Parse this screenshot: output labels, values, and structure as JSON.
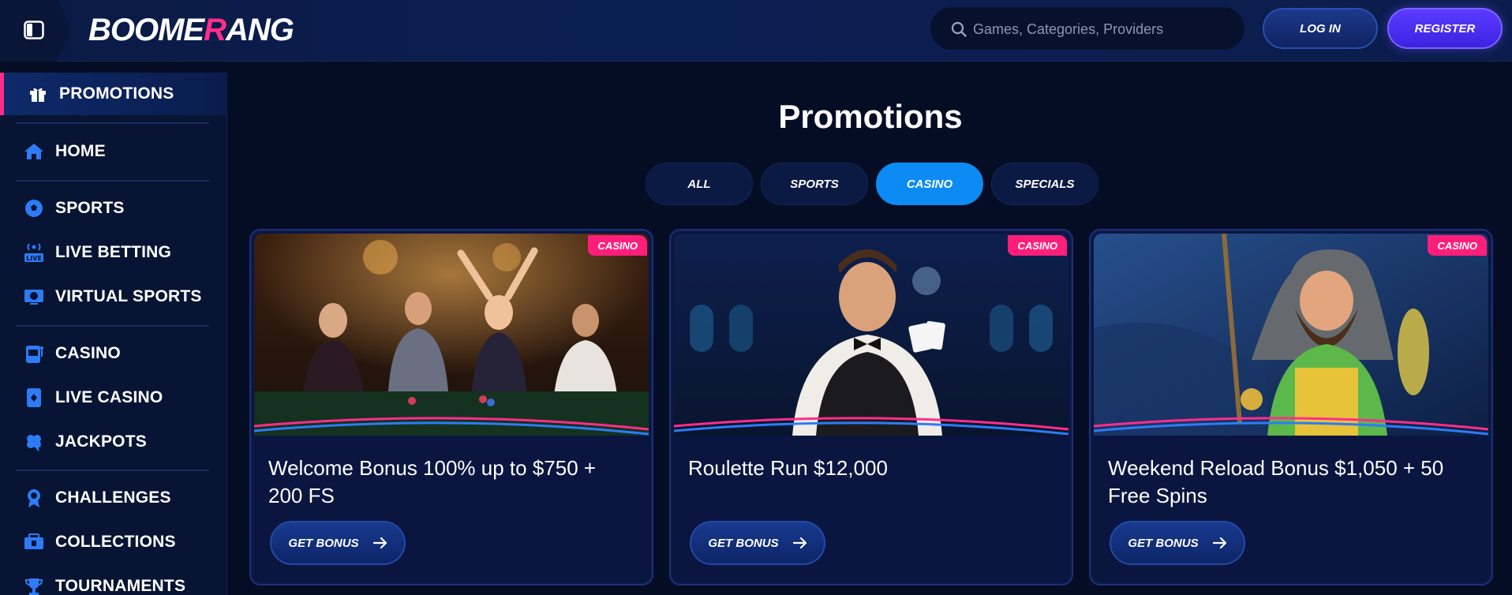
{
  "header": {
    "logo_text_a": "BOOME",
    "logo_text_b": "R",
    "logo_text_c": "ANG",
    "search_placeholder": "Games, Categories, Providers",
    "login_label": "LOG IN",
    "register_label": "REGISTER"
  },
  "sidebar": {
    "items": [
      {
        "label": "PROMOTIONS",
        "icon": "gift-icon"
      },
      {
        "label": "HOME",
        "icon": "home-icon"
      },
      {
        "label": "SPORTS",
        "icon": "soccer-ball-icon"
      },
      {
        "label": "LIVE BETTING",
        "icon": "live-broadcast-icon"
      },
      {
        "label": "VIRTUAL SPORTS",
        "icon": "monitor-ball-icon"
      },
      {
        "label": "CASINO",
        "icon": "slot-machine-icon"
      },
      {
        "label": "LIVE CASINO",
        "icon": "playing-card-icon"
      },
      {
        "label": "JACKPOTS",
        "icon": "clover-icon"
      },
      {
        "label": "CHALLENGES",
        "icon": "medal-icon"
      },
      {
        "label": "COLLECTIONS",
        "icon": "collection-icon"
      },
      {
        "label": "TOURNAMENTS",
        "icon": "trophy-icon"
      }
    ]
  },
  "main": {
    "title": "Promotions",
    "tabs": [
      {
        "label": "ALL"
      },
      {
        "label": "SPORTS"
      },
      {
        "label": "CASINO"
      },
      {
        "label": "SPECIALS"
      }
    ],
    "active_tab": "CASINO",
    "cards": [
      {
        "badge": "CASINO",
        "title": "Welcome Bonus 100% up to $750 + 200 FS",
        "button": "GET BONUS"
      },
      {
        "badge": "CASINO",
        "title": "Roulette Run $12,000",
        "button": "GET BONUS"
      },
      {
        "badge": "CASINO",
        "title": "Weekend Reload Bonus $1,050 + 50 Free Spins",
        "button": "GET BONUS"
      }
    ]
  },
  "colors": {
    "background": "#050d24",
    "accent_pink": "#ff1f7a",
    "active_tab": "#0c8bf5",
    "register": "#4a2df0"
  }
}
